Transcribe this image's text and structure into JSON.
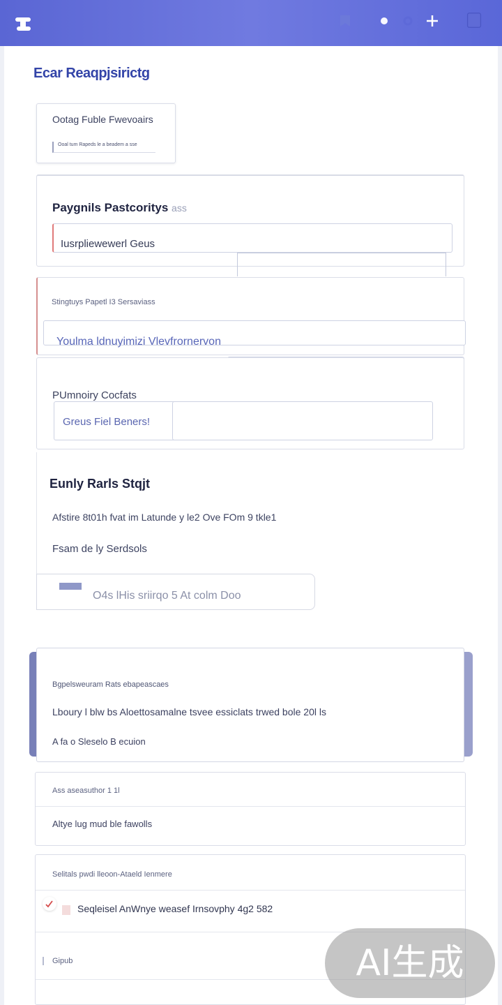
{
  "header": {
    "icons": [
      "logo-icon",
      "bookmark-icon",
      "dot-icon",
      "settings-icon",
      "add-icon",
      "window-icon"
    ]
  },
  "page": {
    "title": "Ecar Reaqpjsirictg"
  },
  "top_card": {
    "title": "Ootag Fuble Fwevoairs",
    "subtitle": "Ooal tum Rapeds le a beadem a sse"
  },
  "payments": {
    "heading": "Paygnils Pastcoritys",
    "heading_suffix": "ass",
    "input_value": "Iusrpliewewerl Geus"
  },
  "settings": {
    "label": "Stingtuys Papetl I3 Sersaviass",
    "field_value": "Youlma ldnuyimizi Vlevfrornervon"
  },
  "primary": {
    "label": "PUmnoiry Cocfats",
    "input_value": "Greus Fiel Beners!"
  },
  "early": {
    "heading": "Eunly Rarls Stqjt",
    "line1": "Afstire 8t01h fvat im Latunde y le2 Ove FOm 9 tkle1",
    "line2": "Fsam de ly Serdsols",
    "pill_text": "O4s lHis sriirqo 5 At colm Doo"
  },
  "purple_card": {
    "label": "Bgpelsweuram Rats ebapeascaes",
    "line1": "Lboury l blw bs Aloettosamalne tsvee essiclats trwed bole 20l ls",
    "line2": "A fa o Sleselo B ecuion"
  },
  "card2": {
    "label": "Ass aseasuthor 1 1l",
    "line": "Altye lug mud ble fawolls"
  },
  "card3": {
    "label": "Selitals pwdi lleoon-Ataeld Ienmere",
    "line": "Seqleisel AnWnye weasef Irnsovphy 4g2 582",
    "row2": "Gipub"
  },
  "watermark": {
    "text": "AI生成"
  }
}
